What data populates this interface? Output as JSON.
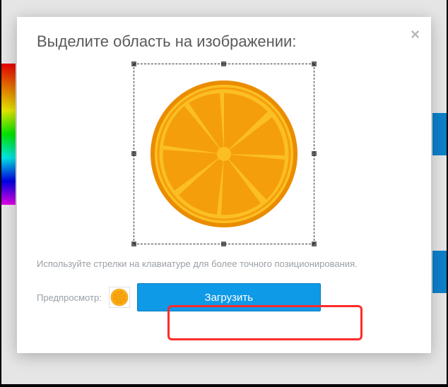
{
  "modal": {
    "title": "Выделите область на изображении:",
    "hint": "Используйте стрелки на клавиатуре для более точного позиционирования.",
    "preview_label": "Предпросмотр:",
    "upload_label": "Загрузить"
  },
  "image": {
    "name": "orange-slice",
    "fill_main": "#f59e0b",
    "fill_inner": "#fbbf24",
    "stroke": "#ea8c00"
  },
  "colors": {
    "primary_button": "#0f9ae8",
    "highlight": "#ff2a2a"
  }
}
